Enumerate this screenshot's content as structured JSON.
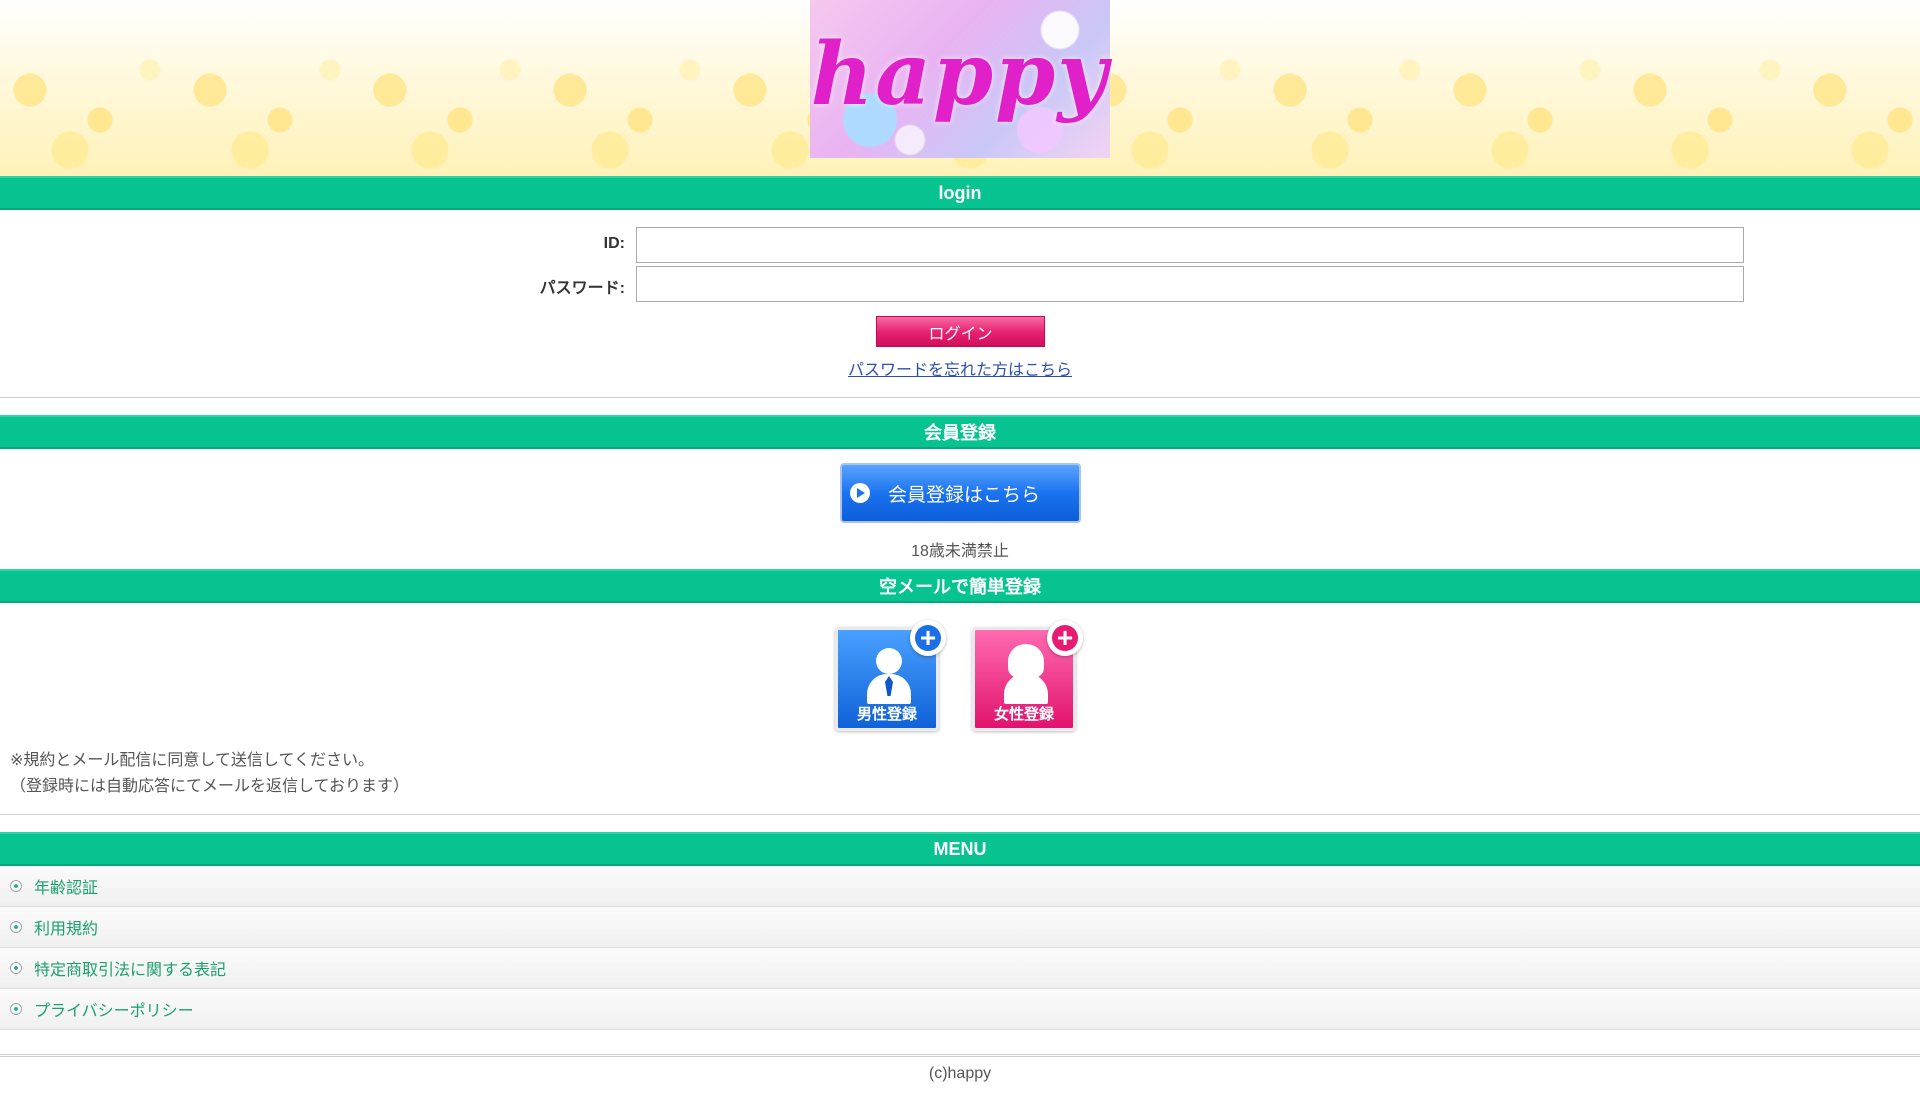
{
  "header": {
    "logo_text": "happy"
  },
  "login": {
    "title": "login",
    "id_label": "ID:",
    "password_label": "パスワード:",
    "submit_label": "ログイン",
    "forgot_link": "パスワードを忘れた方はこちら"
  },
  "member": {
    "title": "会員登録",
    "register_button": "会員登録はこちら",
    "age_note": "18歳未満禁止"
  },
  "mail_register": {
    "title": "空メールで簡単登録",
    "male_label": "男性登録",
    "female_label": "女性登録",
    "note_line1": "※規約とメール配信に同意して送信してください。",
    "note_line2": "（登録時には自動応答にてメールを返信しております）"
  },
  "menu": {
    "title": "MENU",
    "items": [
      {
        "label": "年齢認証"
      },
      {
        "label": "利用規約"
      },
      {
        "label": "特定商取引法に関する表記"
      },
      {
        "label": "プライバシーポリシー"
      }
    ]
  },
  "footer": {
    "copyright": "(c)happy"
  },
  "colors": {
    "section_bar": "#06c38f",
    "login_button": "#e6206f",
    "register_button": "#1b73f0",
    "link": "#2a4fb0",
    "menu_link": "#1aa06f"
  }
}
